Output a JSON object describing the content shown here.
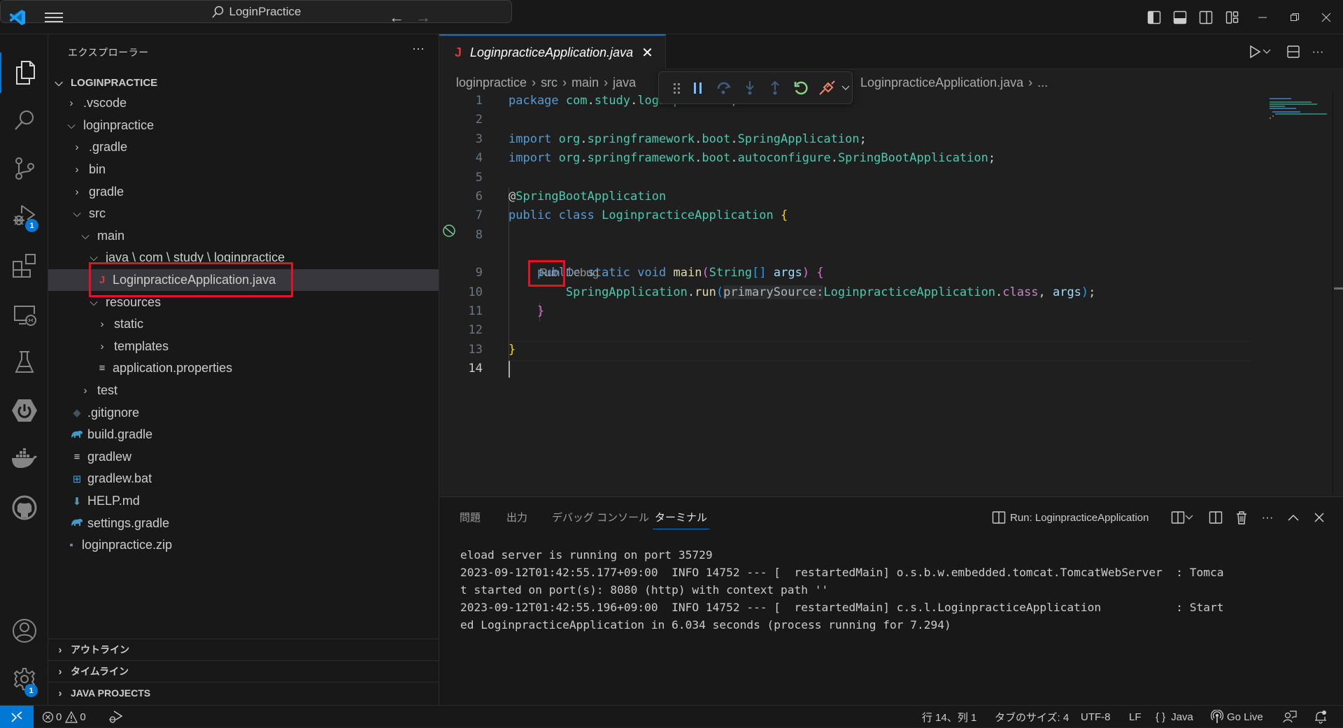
{
  "titlebar": {
    "search_text": "LoginPractice"
  },
  "activity_bar": {
    "items": [
      {
        "name": "explorer",
        "badge": null
      },
      {
        "name": "search",
        "badge": null
      },
      {
        "name": "source-control",
        "badge": null
      },
      {
        "name": "run-and-debug",
        "badge": "1"
      },
      {
        "name": "extensions",
        "badge": null
      },
      {
        "name": "remote-explorer",
        "badge": null
      },
      {
        "name": "testing",
        "badge": null
      },
      {
        "name": "spring-boot-dashboard",
        "badge": null
      },
      {
        "name": "docker",
        "badge": null
      },
      {
        "name": "github",
        "badge": null
      }
    ],
    "bottom": [
      {
        "name": "accounts",
        "badge": null
      },
      {
        "name": "manage",
        "badge": "1"
      }
    ]
  },
  "sidebar": {
    "title": "エクスプローラー",
    "more": "···",
    "root": "LOGINPRACTICE",
    "tree": [
      {
        "label": ".vscode",
        "type": "folder",
        "expanded": false,
        "depth": 1
      },
      {
        "label": "loginpractice",
        "type": "folder",
        "expanded": true,
        "depth": 1
      },
      {
        "label": ".gradle",
        "type": "folder",
        "expanded": false,
        "depth": 2
      },
      {
        "label": "bin",
        "type": "folder",
        "expanded": false,
        "depth": 2
      },
      {
        "label": "gradle",
        "type": "folder",
        "expanded": false,
        "depth": 2
      },
      {
        "label": "src",
        "type": "folder",
        "expanded": true,
        "depth": 2
      },
      {
        "label": "main",
        "type": "folder",
        "expanded": true,
        "depth": 3
      },
      {
        "label": "java \\ com \\ study \\ loginpractice",
        "type": "folder",
        "expanded": true,
        "depth": 4
      },
      {
        "label": "LoginpracticeApplication.java",
        "type": "java",
        "depth": 5,
        "selected": true
      },
      {
        "label": "resources",
        "type": "folder",
        "expanded": true,
        "depth": 4
      },
      {
        "label": "static",
        "type": "folder",
        "expanded": false,
        "depth": 5
      },
      {
        "label": "templates",
        "type": "folder",
        "expanded": false,
        "depth": 5
      },
      {
        "label": "application.properties",
        "type": "properties",
        "depth": 5
      },
      {
        "label": "test",
        "type": "folder",
        "expanded": false,
        "depth": 3
      },
      {
        "label": ".gitignore",
        "type": "git",
        "depth": 2
      },
      {
        "label": "build.gradle",
        "type": "gradle",
        "depth": 2
      },
      {
        "label": "gradlew",
        "type": "text",
        "depth": 2
      },
      {
        "label": "gradlew.bat",
        "type": "windows",
        "depth": 2
      },
      {
        "label": "HELP.md",
        "type": "markdown",
        "depth": 2
      },
      {
        "label": "settings.gradle",
        "type": "gradle",
        "depth": 2
      },
      {
        "label": "loginpractice.zip",
        "type": "zip",
        "depth": 1
      }
    ],
    "sections": [
      "アウトライン",
      "タイムライン",
      "JAVA PROJECTS"
    ]
  },
  "editor": {
    "tab": {
      "label": "LoginpracticeApplication.java",
      "icon": "J"
    },
    "breadcrumb": [
      "loginpractice",
      "src",
      "main",
      "java"
    ],
    "breadcrumb_file": "LoginpracticeApplication.java",
    "breadcrumb_tail": "...",
    "codelens": {
      "run": "Run",
      "debug": "Debug"
    },
    "current_line": 14,
    "lines": [
      {
        "n": "1",
        "tokens": [
          [
            "kw",
            "package"
          ],
          [
            "pl",
            " "
          ],
          [
            "ns",
            "com"
          ],
          [
            "pl",
            "."
          ],
          [
            "ns",
            "study"
          ],
          [
            "pl",
            "."
          ],
          [
            "ns",
            "loginpractice"
          ],
          [
            "pl",
            ";"
          ]
        ]
      },
      {
        "n": "2",
        "tokens": []
      },
      {
        "n": "3",
        "tokens": [
          [
            "kw",
            "import"
          ],
          [
            "pl",
            " "
          ],
          [
            "ns",
            "org"
          ],
          [
            "pl",
            "."
          ],
          [
            "ns",
            "springframework"
          ],
          [
            "pl",
            "."
          ],
          [
            "ns",
            "boot"
          ],
          [
            "pl",
            "."
          ],
          [
            "ty",
            "SpringApplication"
          ],
          [
            "pl",
            ";"
          ]
        ]
      },
      {
        "n": "4",
        "tokens": [
          [
            "kw",
            "import"
          ],
          [
            "pl",
            " "
          ],
          [
            "ns",
            "org"
          ],
          [
            "pl",
            "."
          ],
          [
            "ns",
            "springframework"
          ],
          [
            "pl",
            "."
          ],
          [
            "ns",
            "boot"
          ],
          [
            "pl",
            "."
          ],
          [
            "ns",
            "autoconfigure"
          ],
          [
            "pl",
            "."
          ],
          [
            "ty",
            "SpringBootApplication"
          ],
          [
            "pl",
            ";"
          ]
        ]
      },
      {
        "n": "5",
        "tokens": []
      },
      {
        "n": "6",
        "tokens": [
          [
            "pl",
            "@"
          ],
          [
            "an",
            "SpringBootApplication"
          ]
        ]
      },
      {
        "n": "7",
        "tokens": [
          [
            "kw",
            "public"
          ],
          [
            "pl",
            " "
          ],
          [
            "kw",
            "class"
          ],
          [
            "pl",
            " "
          ],
          [
            "ty",
            "LoginpracticeApplication"
          ],
          [
            "pl",
            " "
          ],
          [
            "br1",
            "{"
          ]
        ]
      },
      {
        "n": "8",
        "tokens": []
      },
      {
        "n": "9",
        "tokens": [
          [
            "pl",
            "    "
          ],
          [
            "kw",
            "public"
          ],
          [
            "pl",
            " "
          ],
          [
            "kw",
            "static"
          ],
          [
            "pl",
            " "
          ],
          [
            "kw",
            "void"
          ],
          [
            "pl",
            " "
          ],
          [
            "fn",
            "main"
          ],
          [
            "br2",
            "("
          ],
          [
            "ty",
            "String"
          ],
          [
            "br3",
            "[]"
          ],
          [
            "pl",
            " "
          ],
          [
            "va",
            "args"
          ],
          [
            "br2",
            ")"
          ],
          [
            "pl",
            " "
          ],
          [
            "br2",
            "{"
          ]
        ]
      },
      {
        "n": "10",
        "tokens": [
          [
            "pl",
            "        "
          ],
          [
            "ty",
            "SpringApplication"
          ],
          [
            "pl",
            "."
          ],
          [
            "fn",
            "run"
          ],
          [
            "br3",
            "("
          ],
          [
            "hint",
            "primarySource:"
          ],
          [
            "ty",
            "LoginpracticeApplication"
          ],
          [
            "pl",
            "."
          ],
          [
            "ckw",
            "class"
          ],
          [
            "pl",
            ", "
          ],
          [
            "va",
            "args"
          ],
          [
            "br3",
            ")"
          ],
          [
            "pl",
            ";"
          ]
        ]
      },
      {
        "n": "11",
        "tokens": [
          [
            "pl",
            "    "
          ],
          [
            "br2",
            "}"
          ]
        ]
      },
      {
        "n": "12",
        "tokens": []
      },
      {
        "n": "13",
        "tokens": [
          [
            "br1",
            "}"
          ]
        ]
      },
      {
        "n": "14",
        "tokens": []
      }
    ]
  },
  "panel": {
    "tabs": [
      {
        "label": "問題",
        "active": false
      },
      {
        "label": "出力",
        "active": false
      },
      {
        "label": "デバッグ コンソール",
        "active": false
      },
      {
        "label": "ターミナル",
        "active": true
      }
    ],
    "terminal_title": "Run: LoginpracticeApplication",
    "terminal_lines": [
      "eload server is running on port 35729",
      "2023-09-12T01:42:55.177+09:00  INFO 14752 --- [  restartedMain] o.s.b.w.embedded.tomcat.TomcatWebServer  : Tomca",
      "t started on port(s): 8080 (http) with context path ''",
      "2023-09-12T01:42:55.196+09:00  INFO 14752 --- [  restartedMain] c.s.l.LoginpracticeApplication           : Start",
      "ed LoginpracticeApplication in 6.034 seconds (process running for 7.294)"
    ]
  },
  "statusbar": {
    "errors": "0",
    "warnings": "0",
    "position": "行 14、列 1",
    "tab_size": "タブのサイズ: 4",
    "encoding": "UTF-8",
    "eol": "LF",
    "language": "Java",
    "language_icon": "{ }",
    "go_live": "Go Live"
  },
  "colors": {
    "accent": "#0078d4",
    "highlight_box": "#e81123",
    "java_icon": "#d9363e"
  }
}
